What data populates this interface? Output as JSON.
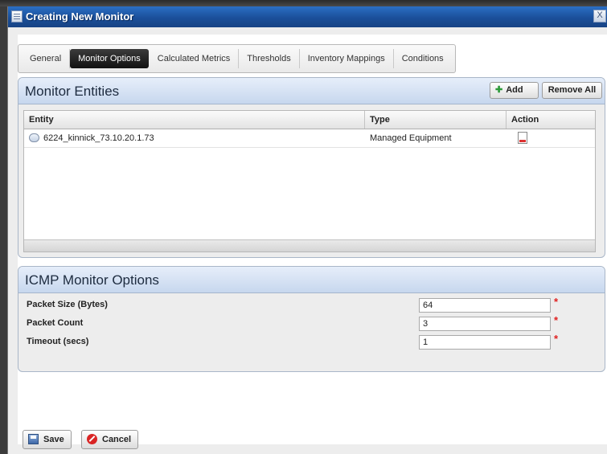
{
  "window": {
    "title": "Creating New Monitor",
    "close": "X"
  },
  "tabs": [
    {
      "label": "General"
    },
    {
      "label": "Monitor Options",
      "active": true
    },
    {
      "label": "Calculated Metrics"
    },
    {
      "label": "Thresholds"
    },
    {
      "label": "Inventory Mappings"
    },
    {
      "label": "Conditions"
    }
  ],
  "entities": {
    "title": "Monitor Entities",
    "add_label": "Add",
    "remove_all_label": "Remove All",
    "columns": {
      "entity": "Entity",
      "type": "Type",
      "action": "Action"
    },
    "rows": [
      {
        "entity": "6224_kinnick_73.10.20.1.73",
        "type": "Managed Equipment",
        "action_icon": "delete-doc-icon"
      }
    ]
  },
  "icmp": {
    "title": "ICMP Monitor Options",
    "fields": [
      {
        "label": "Packet Size (Bytes)",
        "value": "64",
        "required": true
      },
      {
        "label": "Packet Count",
        "value": "3",
        "required": true
      },
      {
        "label": "Timeout (secs)",
        "value": "1",
        "required": true
      }
    ]
  },
  "footer": {
    "save_label": "Save",
    "cancel_label": "Cancel"
  },
  "colors": {
    "titlebar": "#1b4f9a",
    "active_tab": "#111111",
    "required": "#e02020"
  }
}
